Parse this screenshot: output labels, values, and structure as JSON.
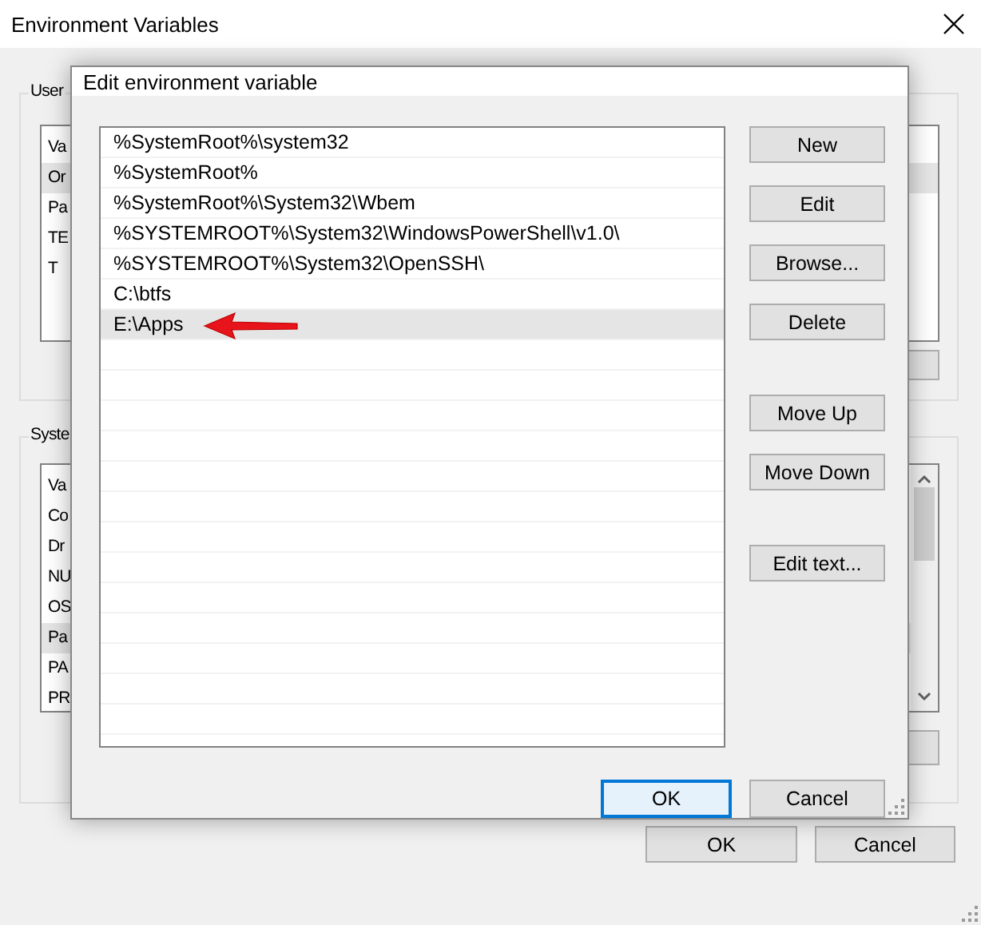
{
  "window": {
    "title": "Environment Variables",
    "user_group": {
      "label": "User",
      "items": [
        {
          "text": "Va",
          "selected": false
        },
        {
          "text": "Or",
          "selected": true
        },
        {
          "text": "Pa",
          "selected": false
        },
        {
          "text": "TE",
          "selected": false
        },
        {
          "text": "T",
          "selected": false
        }
      ]
    },
    "system_group": {
      "label": "Syste",
      "items": [
        {
          "text": "Va",
          "selected": false
        },
        {
          "text": "Co",
          "selected": false
        },
        {
          "text": "Dr",
          "selected": false
        },
        {
          "text": "NU",
          "selected": false
        },
        {
          "text": "OS",
          "selected": false
        },
        {
          "text": "Pa",
          "selected": true
        },
        {
          "text": "PA",
          "selected": false
        },
        {
          "text": "PR",
          "selected": false
        }
      ]
    },
    "footer_buttons": [
      {
        "label": "OK",
        "default": false
      },
      {
        "label": "Cancel",
        "default": false
      }
    ]
  },
  "dialog": {
    "title": "Edit environment variable",
    "paths": [
      {
        "text": "%SystemRoot%\\system32",
        "selected": false
      },
      {
        "text": "%SystemRoot%",
        "selected": false
      },
      {
        "text": "%SystemRoot%\\System32\\Wbem",
        "selected": false
      },
      {
        "text": "%SYSTEMROOT%\\System32\\WindowsPowerShell\\v1.0\\",
        "selected": false
      },
      {
        "text": "%SYSTEMROOT%\\System32\\OpenSSH\\",
        "selected": false
      },
      {
        "text": "C:\\btfs",
        "selected": false
      },
      {
        "text": "E:\\Apps",
        "selected": true
      }
    ],
    "button_groups": [
      [
        "New",
        "Edit",
        "Browse...",
        "Delete"
      ],
      [
        "Move Up",
        "Move Down"
      ],
      [
        "Edit text..."
      ]
    ],
    "footer_buttons": [
      {
        "label": "OK",
        "default": true
      },
      {
        "label": "Cancel",
        "default": false
      }
    ]
  }
}
